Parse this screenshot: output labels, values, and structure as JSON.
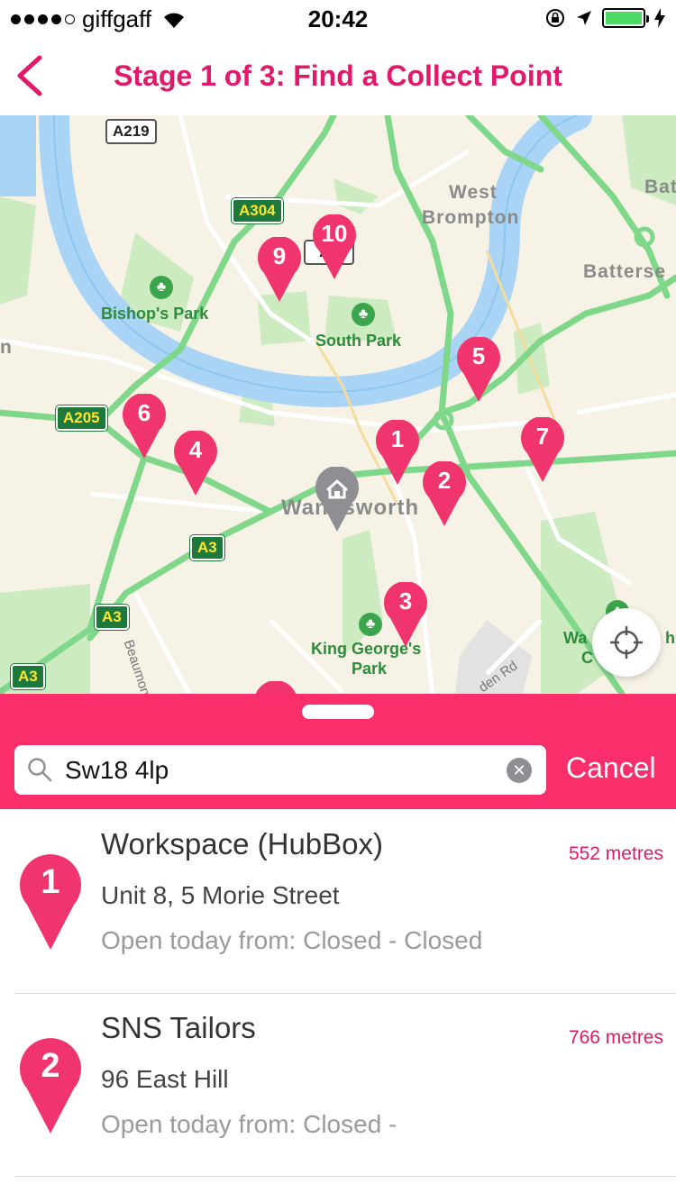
{
  "status_bar": {
    "carrier": "giffgaff",
    "time": "20:42"
  },
  "nav": {
    "title": "Stage 1 of 3: Find a Collect Point"
  },
  "map": {
    "labels": {
      "west_brompton_1": "West",
      "west_brompton_2": "Brompton",
      "battersea": "Batterse",
      "battersea_top": "Bat",
      "bishops_park": "Bishop's Park",
      "south_park": "South Park",
      "wandsworth": "Wandsworth",
      "king_georges_1": "King George's",
      "king_georges_2": "Park",
      "beaumont_rd": "Beaumont Rd",
      "garden_rd": "den Rd",
      "wandsworth_c": "Wa",
      "wandsworth_c2": "C",
      "edge_n": "n",
      "edge_h": "h"
    },
    "road_shields": {
      "a219": "A219",
      "a304": "A304",
      "a205": "A205",
      "a3_1": "A3",
      "a3_2": "A3",
      "a3_3": "A3",
      "a3_top": "A3"
    },
    "pins": [
      "1",
      "2",
      "3",
      "4",
      "5",
      "6",
      "7",
      "9",
      "10"
    ],
    "colors": {
      "pin": "#f0356e",
      "water": "#a9d4f5",
      "park": "#cdebc0",
      "road_major": "#7fd88a"
    }
  },
  "search": {
    "value": "Sw18 4lp",
    "cancel_label": "Cancel"
  },
  "results": [
    {
      "number": "1",
      "name": "Workspace (HubBox)",
      "distance": "552 metres",
      "address": "Unit 8, 5 Morie Street",
      "hours": "Open today from: Closed - Closed"
    },
    {
      "number": "2",
      "name": "SNS Tailors",
      "distance": "766 metres",
      "address": "96 East Hill",
      "hours": "Open today from: Closed -"
    }
  ],
  "accent_color": "#fa2e6a"
}
